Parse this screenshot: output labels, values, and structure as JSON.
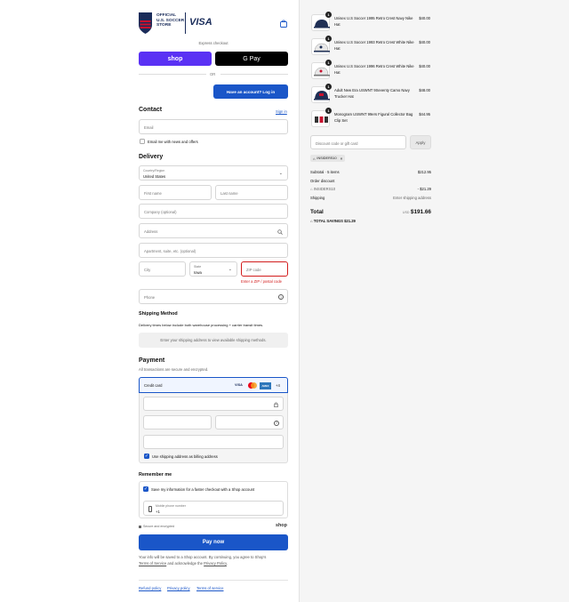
{
  "brand": {
    "logo_text": "USA",
    "store_lines": [
      "OFFICIAL",
      "U.S. SOCCER",
      "STORE"
    ],
    "visa": "VISA"
  },
  "express": {
    "label": "Express checkout",
    "shop": "shop",
    "gpay": "G Pay",
    "or": "OR",
    "account_button": "Have an account? Log in"
  },
  "contact": {
    "title": "Contact",
    "sign_in": "Sign in",
    "email_placeholder": "Email",
    "news_label": "Email me with news and offers"
  },
  "delivery": {
    "title": "Delivery",
    "country_label": "Country/Region",
    "country_value": "United States",
    "first_name": "First name",
    "last_name": "Last name",
    "company": "Company (optional)",
    "address": "Address",
    "apartment": "Apartment, suite, etc. (optional)",
    "city": "City",
    "state_label": "State",
    "state_value": "Iowa",
    "zip": "ZIP code",
    "zip_error": "Enter a ZIP / postal code",
    "phone": "Phone"
  },
  "shipping": {
    "title": "Shipping Method",
    "note": "Delivery times below include both warehouse processing + carrier transit times.",
    "placeholder": "Enter your shipping address to view available shipping methods."
  },
  "payment": {
    "title": "Payment",
    "subtitle": "All transactions are secure and encrypted.",
    "method": "Credit card",
    "more": "+4",
    "card_logos": [
      "VISA",
      "MC",
      "AMEX"
    ],
    "billing_label": "Use shipping address as billing address"
  },
  "remember": {
    "title": "Remember me",
    "save_label": "Save my information for a faster checkout with a Shop account",
    "mobile_label": "Mobile phone number",
    "mobile_value": "+1",
    "secure": "Secure and encrypted",
    "shop": "shop"
  },
  "pay_button": "Pay now",
  "legal": {
    "line1": "Your info will be saved to a Shop account. By continuing, you agree to Shop's",
    "terms": "Terms of Service",
    "middle": "and acknowledge the",
    "privacy": "Privacy Policy",
    "end": "."
  },
  "footer": {
    "refund": "Refund policy",
    "privacy": "Privacy policy",
    "terms": "Terms of service"
  },
  "cart": {
    "items": [
      {
        "qty": "1",
        "name": "Unisex U.S Soccer 1995 Retro Crest Navy Nike Hat",
        "price": "$40.00"
      },
      {
        "qty": "1",
        "name": "Unisex U.S Soccer 1993 Retro Crest White Nike Hat",
        "price": "$40.00"
      },
      {
        "qty": "1",
        "name": "Unisex U.S Soccer 1996 Retro Crest White Nike Hat",
        "price": "$40.00"
      },
      {
        "qty": "1",
        "name": "Adult New Era USWNT 9Seventy Camo Navy Trucker Hat",
        "price": "$48.00"
      },
      {
        "qty": "1",
        "name": "Monogram USWNT 99ers Figural Collector Bag Clip Set",
        "price": "$44.95"
      }
    ]
  },
  "discount": {
    "placeholder": "Discount code or gift card",
    "apply": "Apply",
    "code": "INSIDERS10"
  },
  "summary": {
    "subtotal_label": "Subtotal · 5 items",
    "subtotal": "$212.95",
    "order_discount": "Order discount",
    "code": "INSIDERS10",
    "discount": "- $21.29",
    "shipping_label": "Shipping",
    "shipping_value": "Enter shipping address",
    "total_label": "Total",
    "currency": "USD",
    "total": "$191.66",
    "savings_label": "TOTAL SAVINGS",
    "savings": "$21.29"
  }
}
